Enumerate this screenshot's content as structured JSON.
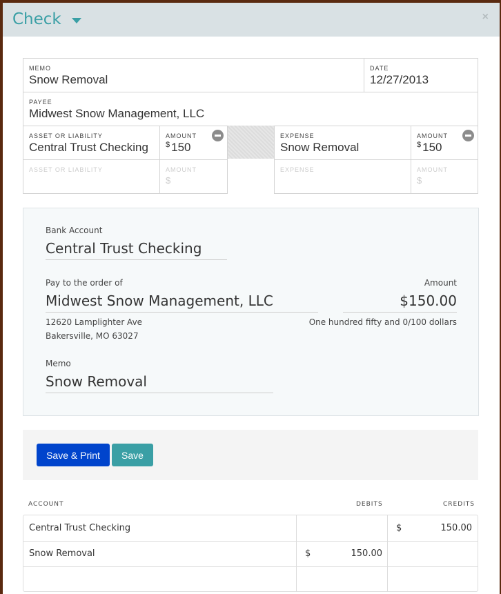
{
  "dialog": {
    "title": "Check",
    "close": "×"
  },
  "form": {
    "memo": {
      "label": "MEMO",
      "value": "Snow Removal"
    },
    "date": {
      "label": "DATE",
      "value": "12/27/2013"
    },
    "payee": {
      "label": "PAYEE",
      "value": "Midwest Snow Management, LLC"
    },
    "splits_left": [
      {
        "label": "ASSET OR LIABILITY",
        "value": "Central Trust Checking",
        "amount_label": "AMOUNT",
        "currency": "$",
        "amount": "150"
      },
      {
        "label": "ASSET OR LIABILITY",
        "value": "",
        "amount_label": "AMOUNT",
        "currency": "$",
        "amount": ""
      }
    ],
    "splits_right": [
      {
        "label": "EXPENSE",
        "value": "Snow Removal",
        "amount_label": "AMOUNT",
        "currency": "$",
        "amount": "150"
      },
      {
        "label": "EXPENSE",
        "value": "",
        "amount_label": "AMOUNT",
        "currency": "$",
        "amount": ""
      }
    ]
  },
  "check": {
    "bank_label": "Bank Account",
    "bank": "Central Trust Checking",
    "payto_label": "Pay to the order of",
    "payee": "Midwest Snow Management, LLC",
    "amount_label": "Amount",
    "amount": "$150.00",
    "amount_words": "One hundred fifty and 0/100 dollars",
    "address1": "12620 Lamplighter Ave",
    "address2": "Bakersville, MO 63027",
    "memo_label": "Memo",
    "memo": "Snow Removal"
  },
  "actions": {
    "save_print": "Save & Print",
    "save": "Save",
    "save_print_color": "#0044cc",
    "save_color": "#3a9fa5"
  },
  "ledger": {
    "headers": {
      "account": "ACCOUNT",
      "debits": "DEBITS",
      "credits": "CREDITS"
    },
    "rows": [
      {
        "account": "Central Trust Checking",
        "debit_cur": "",
        "debit": "",
        "credit_cur": "$",
        "credit": "150.00"
      },
      {
        "account": "Snow Removal",
        "debit_cur": "$",
        "debit": "150.00",
        "credit_cur": "",
        "credit": ""
      },
      {
        "account": "",
        "debit_cur": "",
        "debit": "",
        "credit_cur": "",
        "credit": ""
      }
    ]
  }
}
